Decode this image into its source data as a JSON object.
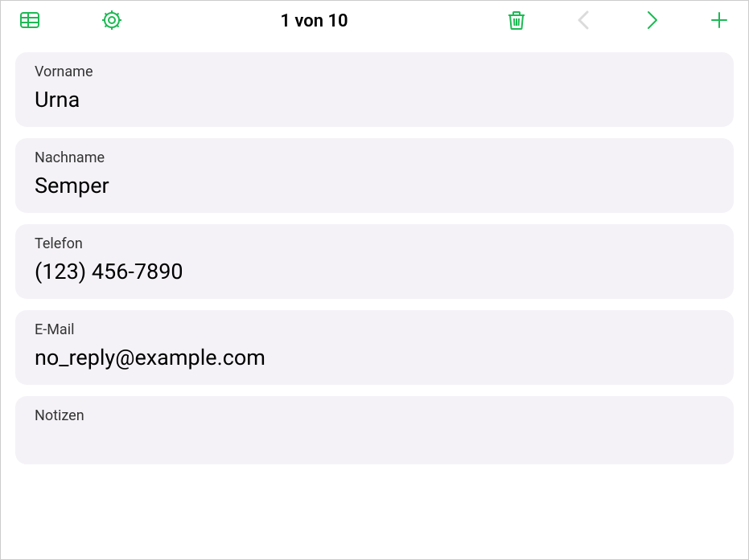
{
  "toolbar": {
    "counter": "1 von 10"
  },
  "fields": {
    "firstname": {
      "label": "Vorname",
      "value": "Urna"
    },
    "lastname": {
      "label": "Nachname",
      "value": "Semper"
    },
    "phone": {
      "label": "Telefon",
      "value": "(123) 456-7890"
    },
    "email": {
      "label": "E-Mail",
      "value": "no_reply@example.com"
    },
    "notes": {
      "label": "Notizen",
      "value": ""
    }
  }
}
